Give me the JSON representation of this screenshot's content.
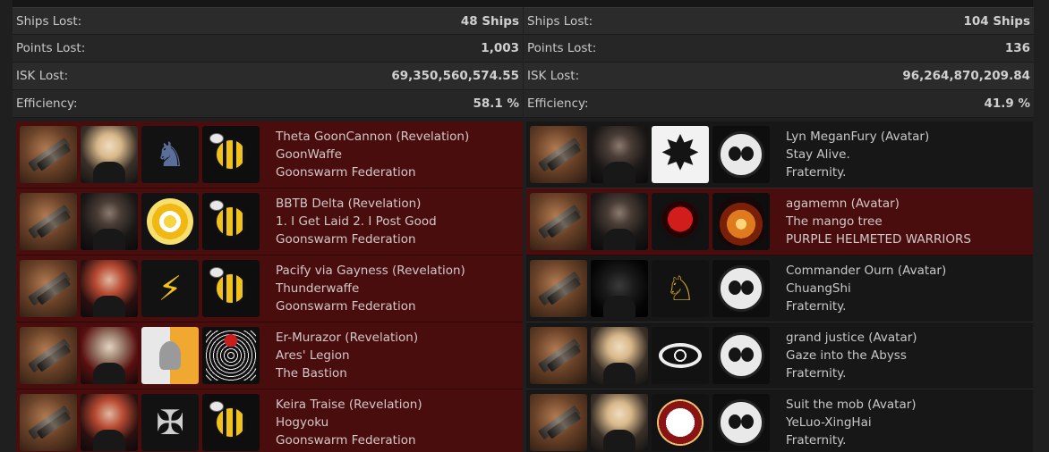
{
  "stats_left": [
    {
      "label": "Ships Lost:",
      "value": "48 Ships"
    },
    {
      "label": "Points Lost:",
      "value": "1,003"
    },
    {
      "label": "ISK Lost:",
      "value": "69,350,560,574.55"
    },
    {
      "label": "Efficiency:",
      "value": "58.1 %"
    }
  ],
  "stats_right": [
    {
      "label": "Ships Lost:",
      "value": "104 Ships"
    },
    {
      "label": "Points Lost:",
      "value": "136"
    },
    {
      "label": "ISK Lost:",
      "value": "96,264,870,209.84"
    },
    {
      "label": "Efficiency:",
      "value": "41.9 %"
    }
  ],
  "kills_left": [
    {
      "pilot": "Theta GoonCannon (Revelation)",
      "corp": "GoonWaffe",
      "alliance": "Goonswarm Federation",
      "highlight": "red"
    },
    {
      "pilot": "BBTB Delta (Revelation)",
      "corp": "1. I Get Laid 2. I Post Good",
      "alliance": "Goonswarm Federation",
      "highlight": "red"
    },
    {
      "pilot": "Pacify via Gayness (Revelation)",
      "corp": "Thunderwaffe",
      "alliance": "Goonswarm Federation",
      "highlight": "red"
    },
    {
      "pilot": "Er-Murazor (Revelation)",
      "corp": "Ares' Legion",
      "alliance": "The Bastion",
      "highlight": "red"
    },
    {
      "pilot": "Keira Traise (Revelation)",
      "corp": "Hogyoku",
      "alliance": "Goonswarm Federation",
      "highlight": "red"
    }
  ],
  "kills_right": [
    {
      "pilot": "Lyn MeganFury (Avatar)",
      "corp": "Stay Alive.",
      "alliance": "Fraternity.",
      "highlight": "dark"
    },
    {
      "pilot": "agamemn (Avatar)",
      "corp": "The mango tree",
      "alliance": "PURPLE HELMETED WARRIORS",
      "highlight": "red"
    },
    {
      "pilot": "Commander Ourn (Avatar)",
      "corp": "ChuangShi",
      "alliance": "Fraternity.",
      "highlight": "dark"
    },
    {
      "pilot": "grand justice (Avatar)",
      "corp": "Gaze into the Abyss",
      "alliance": "Fraternity.",
      "highlight": "dark"
    },
    {
      "pilot": "Suit the mob (Avatar)",
      "corp": "YeLuo-XingHai",
      "alliance": "Fraternity.",
      "highlight": "dark"
    }
  ],
  "icons": {
    "ship": "ship-icon",
    "goonswarm": "bee-logo-icon",
    "fraternity": "panda-logo-icon"
  },
  "colors": {
    "loss_row": "#4a0d0d",
    "neutral_row": "#171717",
    "background": "#1f1f1f"
  }
}
